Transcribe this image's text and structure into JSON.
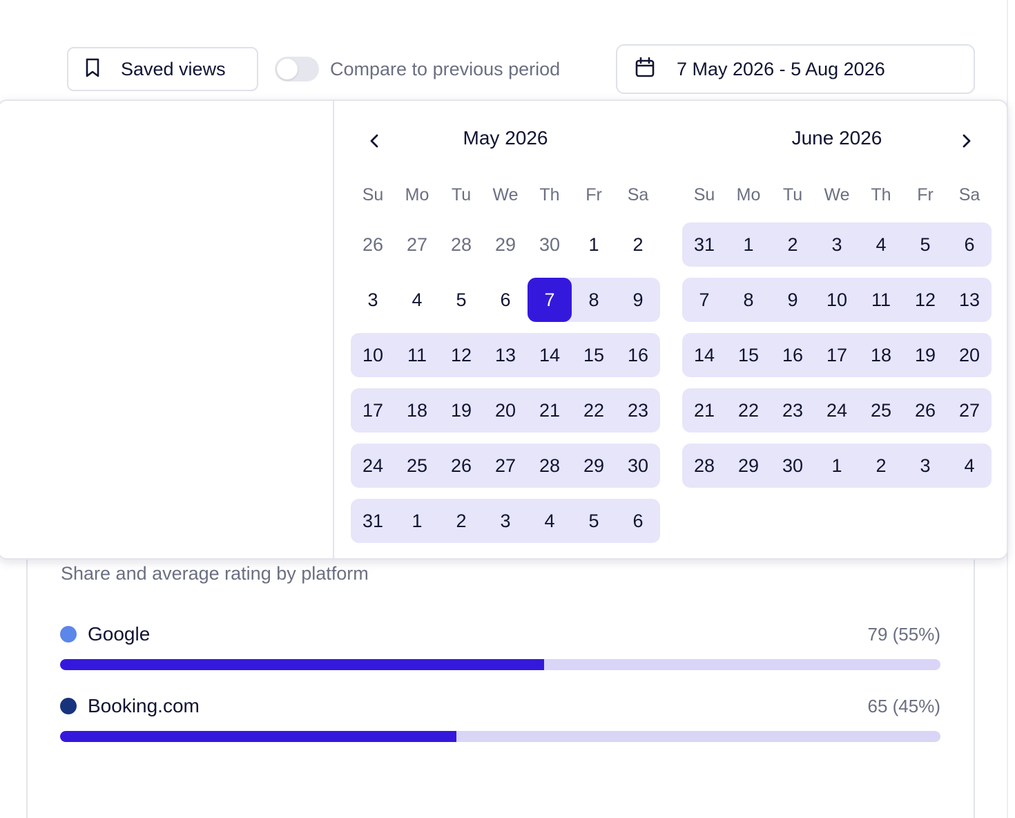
{
  "toolbar": {
    "saved_views_label": "Saved views",
    "compare_label": "Compare to previous period",
    "compare_enabled": false,
    "date_range_label": "7 May 2026 - 5 Aug 2026"
  },
  "calendar": {
    "weekdays": [
      "Su",
      "Mo",
      "Tu",
      "We",
      "Th",
      "Fr",
      "Sa"
    ],
    "months": [
      {
        "title": "May 2026",
        "weeks": [
          [
            "26",
            "27",
            "28",
            "29",
            "30",
            "1",
            "2"
          ],
          [
            "3",
            "4",
            "5",
            "6",
            "7",
            "8",
            "9"
          ],
          [
            "10",
            "11",
            "12",
            "13",
            "14",
            "15",
            "16"
          ],
          [
            "17",
            "18",
            "19",
            "20",
            "21",
            "22",
            "23"
          ],
          [
            "24",
            "25",
            "26",
            "27",
            "28",
            "29",
            "30"
          ],
          [
            "31",
            "1",
            "2",
            "3",
            "4",
            "5",
            "6"
          ]
        ],
        "outside_days": [
          [
            0,
            0
          ],
          [
            0,
            1
          ],
          [
            0,
            2
          ],
          [
            0,
            3
          ],
          [
            0,
            4
          ]
        ],
        "selected_day": [
          1,
          4
        ],
        "range_start": [
          1,
          4
        ]
      },
      {
        "title": "June 2026",
        "weeks": [
          [
            "31",
            "1",
            "2",
            "3",
            "4",
            "5",
            "6"
          ],
          [
            "7",
            "8",
            "9",
            "10",
            "11",
            "12",
            "13"
          ],
          [
            "14",
            "15",
            "16",
            "17",
            "18",
            "19",
            "20"
          ],
          [
            "21",
            "22",
            "23",
            "24",
            "25",
            "26",
            "27"
          ],
          [
            "28",
            "29",
            "30",
            "1",
            "2",
            "3",
            "4"
          ]
        ],
        "outside_days": [],
        "selected_day": null,
        "range_start": [
          0,
          0
        ]
      }
    ]
  },
  "card": {
    "subtitle": "Share and average rating by platform",
    "platforms": [
      {
        "name": "Google",
        "value_label": "79 (55%)",
        "share": 0.55,
        "dot_color": "#5b86ea"
      },
      {
        "name": "Booking.com",
        "value_label": "65 (45%)",
        "share": 0.45,
        "dot_color": "#17337e"
      }
    ]
  },
  "colors": {
    "accent": "#3419dc",
    "range_bg": "#e6e5fa",
    "bar_track": "#d8d5f7"
  }
}
